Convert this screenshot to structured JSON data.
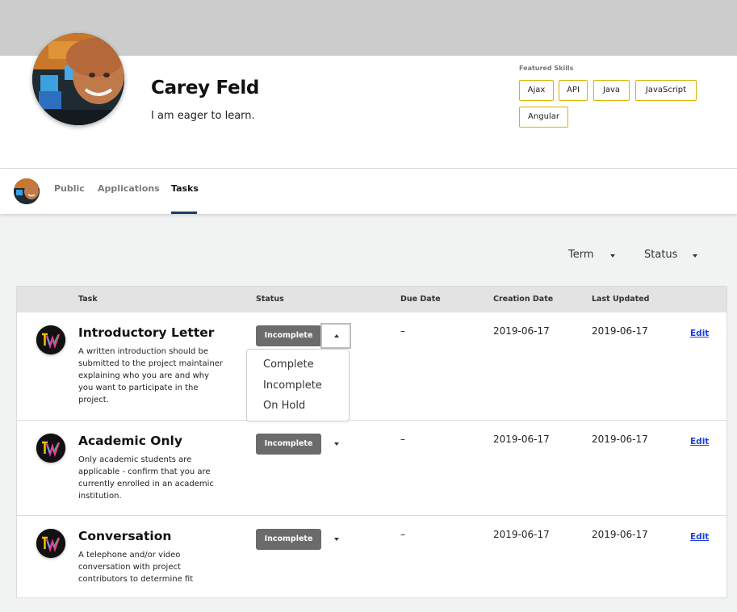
{
  "profile": {
    "name": "Carey Feld",
    "tagline": "I am eager to learn.",
    "skills_title": "Featured Skills",
    "skills": [
      "Ajax",
      "API",
      "Java",
      "JavaScript",
      "Angular"
    ]
  },
  "nav": {
    "tabs": [
      "Public",
      "Applications",
      "Tasks"
    ],
    "active": "Tasks"
  },
  "filters": {
    "term": "Term",
    "status": "Status"
  },
  "table": {
    "headers": {
      "task": "Task",
      "status": "Status",
      "due": "Due Date",
      "created": "Creation Date",
      "updated": "Last Updated"
    },
    "rows": [
      {
        "title": "Introductory Letter",
        "desc": "A written introduction should be submitted to the project maintainer explaining who you are and why you want to participate in the project.",
        "status": "Incomplete",
        "due": "–",
        "created": "2019-06-17",
        "updated": "2019-06-17",
        "edit": "Edit"
      },
      {
        "title": "Academic Only",
        "desc": "Only academic students are applicable - confirm that you are currently enrolled in an academic institution.",
        "status": "Incomplete",
        "due": "–",
        "created": "2019-06-17",
        "updated": "2019-06-17",
        "edit": "Edit"
      },
      {
        "title": "Conversation",
        "desc": "A telephone and/or video conversation with project contributors to determine fit",
        "status": "Incomplete",
        "due": "–",
        "created": "2019-06-17",
        "updated": "2019-06-17",
        "edit": "Edit"
      }
    ]
  },
  "status_menu": {
    "options": [
      "Complete",
      "Incomplete",
      "On Hold"
    ]
  },
  "colors": {
    "banner": "#cccccc",
    "chip_border": "#d9b300",
    "status_button": "#6b6b6b",
    "nav_underline": "#1b3a6b",
    "edit_link": "#1a3ee0"
  },
  "icons": {
    "avatar": "user-photo",
    "task_logo": "tw-logo-icon",
    "caret": "caret-down-icon"
  }
}
